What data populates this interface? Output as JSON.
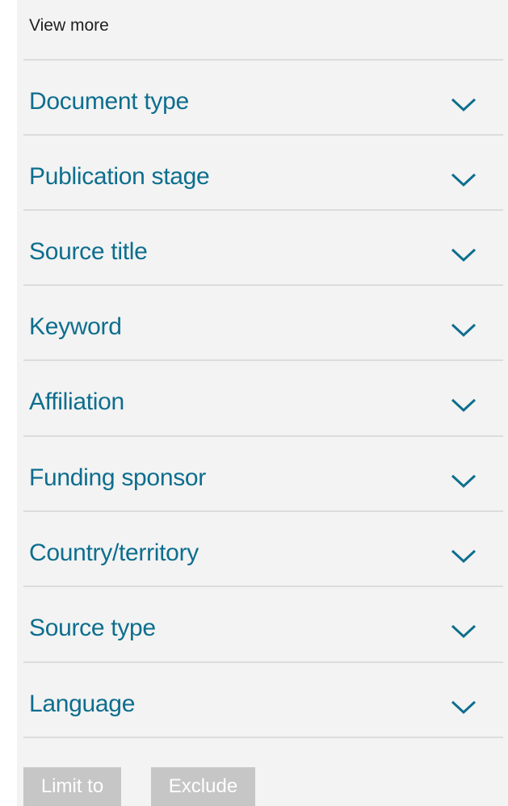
{
  "view_more": "View more",
  "colors": {
    "link": "#0d6e8e",
    "panel_bg": "#f3f3f3",
    "divider": "#dcdcdc",
    "button_bg": "#c6c6c6",
    "button_text": "#ffffff"
  },
  "facets": [
    {
      "label": "Document type",
      "icon": "chevron-down-icon"
    },
    {
      "label": "Publication stage",
      "icon": "chevron-down-icon"
    },
    {
      "label": "Source title",
      "icon": "chevron-down-icon"
    },
    {
      "label": "Keyword",
      "icon": "chevron-down-icon"
    },
    {
      "label": "Affiliation",
      "icon": "chevron-down-icon"
    },
    {
      "label": "Funding sponsor",
      "icon": "chevron-down-icon"
    },
    {
      "label": "Country/territory",
      "icon": "chevron-down-icon"
    },
    {
      "label": "Source type",
      "icon": "chevron-down-icon"
    },
    {
      "label": "Language",
      "icon": "chevron-down-icon"
    }
  ],
  "buttons": {
    "limit_to": "Limit to",
    "exclude": "Exclude"
  }
}
